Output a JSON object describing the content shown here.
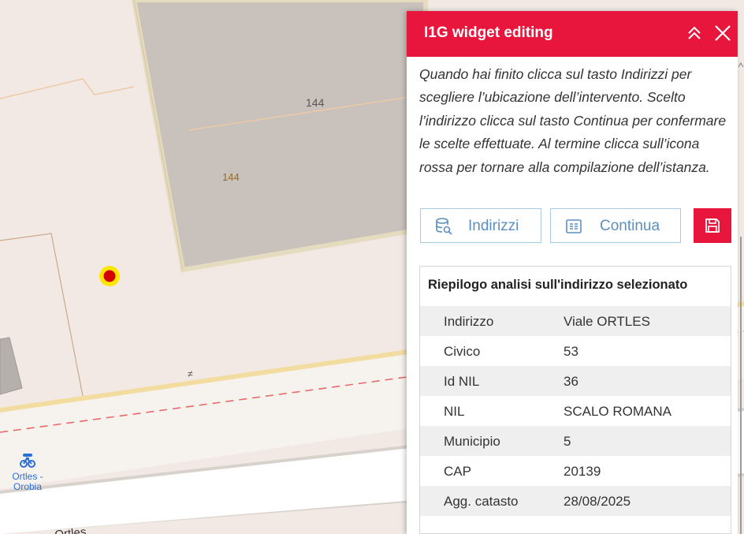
{
  "map": {
    "building_number_gray": "144",
    "building_number_plot": "144",
    "poi_label_line1": "Ortles -",
    "poi_label_line2": "Orobia",
    "street_label": "Ortles"
  },
  "panel": {
    "title": "I1G widget editing",
    "instructions": "Quando hai finito clicca sul tasto Indirizzi per scegliere l’ubicazione dell’intervento. Scelto l’indirizzo clicca sul tasto Continua per confermare le scelte effettuate. Al termine clicca sull’icona rossa per tornare alla compilazione dell’istanza.",
    "buttons": {
      "indirizzi": "Indirizzi",
      "continua": "Continua"
    },
    "summary": {
      "title": "Riepilogo analisi sull'indirizzo selezionato",
      "rows": [
        {
          "key": "Indirizzo",
          "value": "Viale ORTLES"
        },
        {
          "key": "Civico",
          "value": "53"
        },
        {
          "key": "Id NIL",
          "value": "36"
        },
        {
          "key": "NIL",
          "value": "SCALO ROMANA"
        },
        {
          "key": "Municipio",
          "value": "5"
        },
        {
          "key": "CAP",
          "value": "20139"
        },
        {
          "key": "Agg. catasto",
          "value": "28/08/2025"
        }
      ]
    }
  },
  "colors": {
    "accent": "#e8163c",
    "button_border": "#a8cbe4",
    "button_text": "#5b8fbf",
    "map_land": "#f2e9e5",
    "building": "#cfc7c2",
    "poi_blue": "#2a6fd6"
  }
}
